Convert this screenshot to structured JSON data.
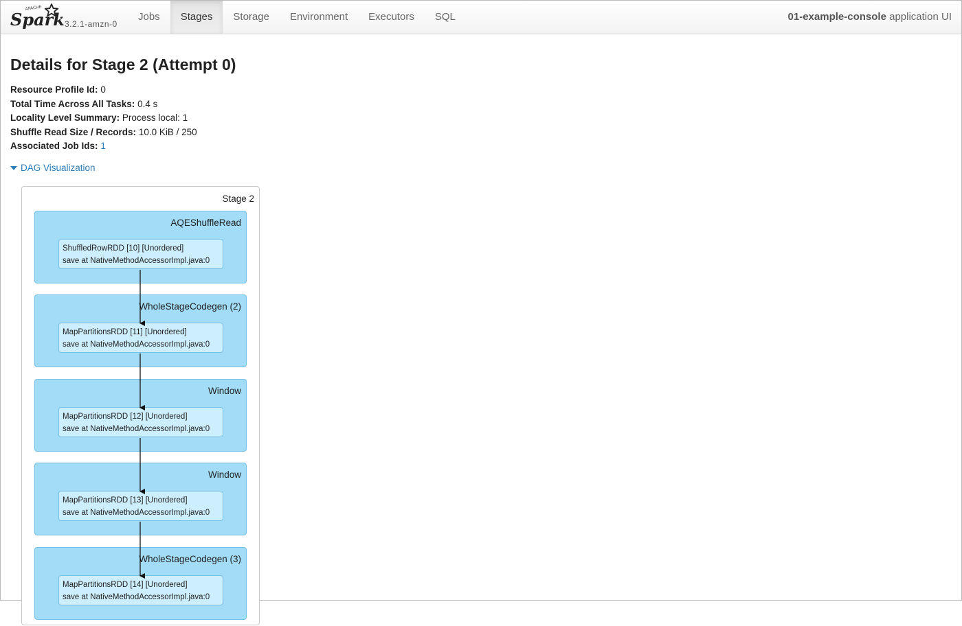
{
  "brand": {
    "logo_text": "Spark",
    "logo_prefix": "APACHE",
    "version": "3.2.1-amzn-0"
  },
  "nav": {
    "tabs": [
      {
        "label": "Jobs",
        "active": false
      },
      {
        "label": "Stages",
        "active": true
      },
      {
        "label": "Storage",
        "active": false
      },
      {
        "label": "Environment",
        "active": false
      },
      {
        "label": "Executors",
        "active": false
      },
      {
        "label": "SQL",
        "active": false
      }
    ],
    "app_name": "01-example-console",
    "app_suffix": "application UI"
  },
  "page": {
    "title": "Details for Stage 2 (Attempt 0)"
  },
  "summary": {
    "resource_profile": {
      "label": "Resource Profile Id:",
      "value": "0"
    },
    "total_time": {
      "label": "Total Time Across All Tasks:",
      "value": "0.4 s"
    },
    "locality": {
      "label": "Locality Level Summary:",
      "value": "Process local: 1"
    },
    "shuffle_read": {
      "label": "Shuffle Read Size / Records:",
      "value": "10.0 KiB / 250"
    },
    "job_ids": {
      "label": "Associated Job Ids:",
      "value": "1"
    }
  },
  "dag": {
    "toggle_label": "DAG Visualization",
    "stage_label": "Stage 2",
    "clusters": [
      {
        "label": "AQEShuffleRead",
        "rdd": "ShuffledRowRDD [10] [Unordered]",
        "callsite": "save at NativeMethodAccessorImpl.java:0"
      },
      {
        "label": "WholeStageCodegen (2)",
        "rdd": "MapPartitionsRDD [11] [Unordered]",
        "callsite": "save at NativeMethodAccessorImpl.java:0"
      },
      {
        "label": "Window",
        "rdd": "MapPartitionsRDD [12] [Unordered]",
        "callsite": "save at NativeMethodAccessorImpl.java:0"
      },
      {
        "label": "Window",
        "rdd": "MapPartitionsRDD [13] [Unordered]",
        "callsite": "save at NativeMethodAccessorImpl.java:0"
      },
      {
        "label": "WholeStageCodegen (3)",
        "rdd": "MapPartitionsRDD [14] [Unordered]",
        "callsite": "save at NativeMethodAccessorImpl.java:0"
      }
    ]
  },
  "colors": {
    "cluster_fill": "#a2dcf7",
    "rdd_fill": "#cdeefc",
    "link": "#2d7bb5"
  }
}
